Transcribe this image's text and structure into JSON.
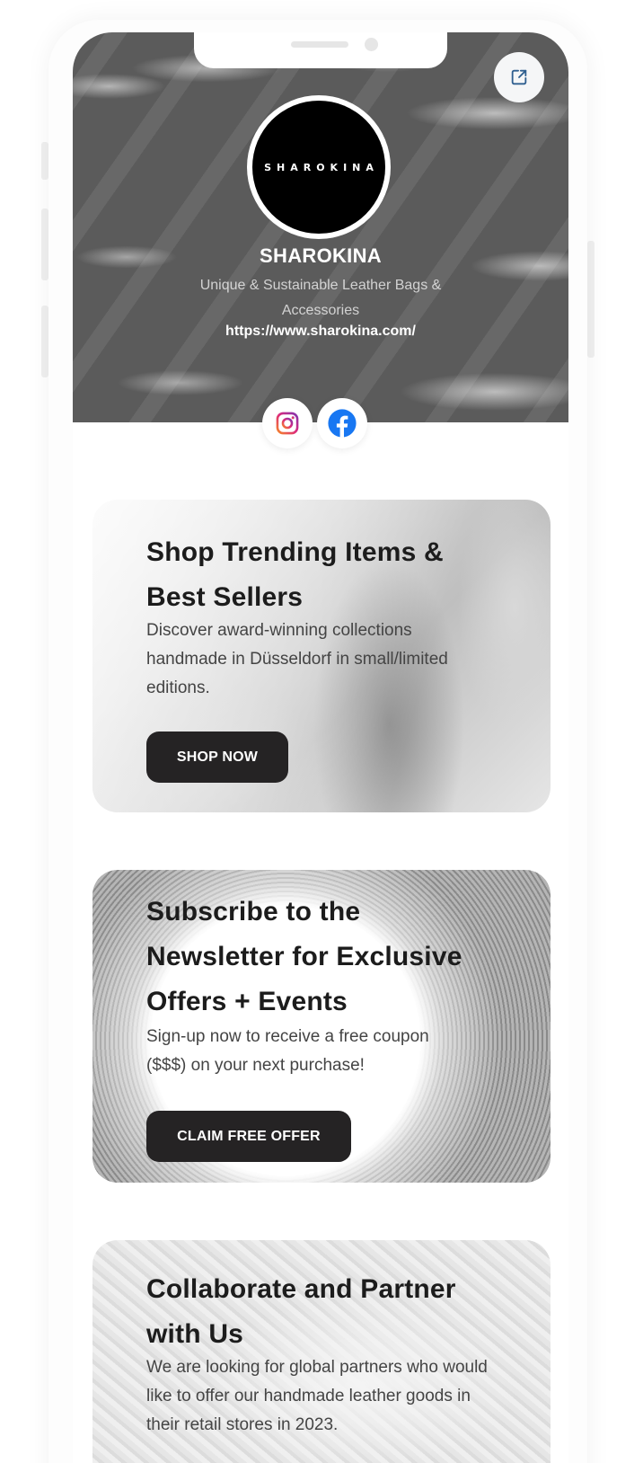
{
  "profile": {
    "logo_text": "SHAROKINA",
    "name": "SHAROKINA",
    "bio": "Unique & Sustainable Leather Bags & Accessories",
    "url": "https://www.sharokina.com/"
  },
  "social": [
    {
      "icon": "instagram-icon"
    },
    {
      "icon": "facebook-icon"
    }
  ],
  "share": {
    "icon": "share-icon"
  },
  "cards": [
    {
      "title": "Shop Trending Items & Best Sellers",
      "description": "Discover award-winning collections handmade in Düsseldorf in small/limited editions.",
      "button": "SHOP NOW"
    },
    {
      "title": "Subscribe to the Newsletter for Exclusive Offers + Events",
      "description": "Sign-up now to receive a free coupon ($$$) on your next purchase!",
      "button": "CLAIM FREE OFFER"
    },
    {
      "title": "Collaborate and Partner with Us",
      "description": "We are looking for global partners who would like to offer our handmade leather goods in their retail stores in 2023."
    }
  ],
  "colors": {
    "button_bg": "#252324",
    "facebook_blue": "#1877f2",
    "instagram_gradient": [
      "#f58529",
      "#dd2a7b",
      "#8134af"
    ]
  }
}
